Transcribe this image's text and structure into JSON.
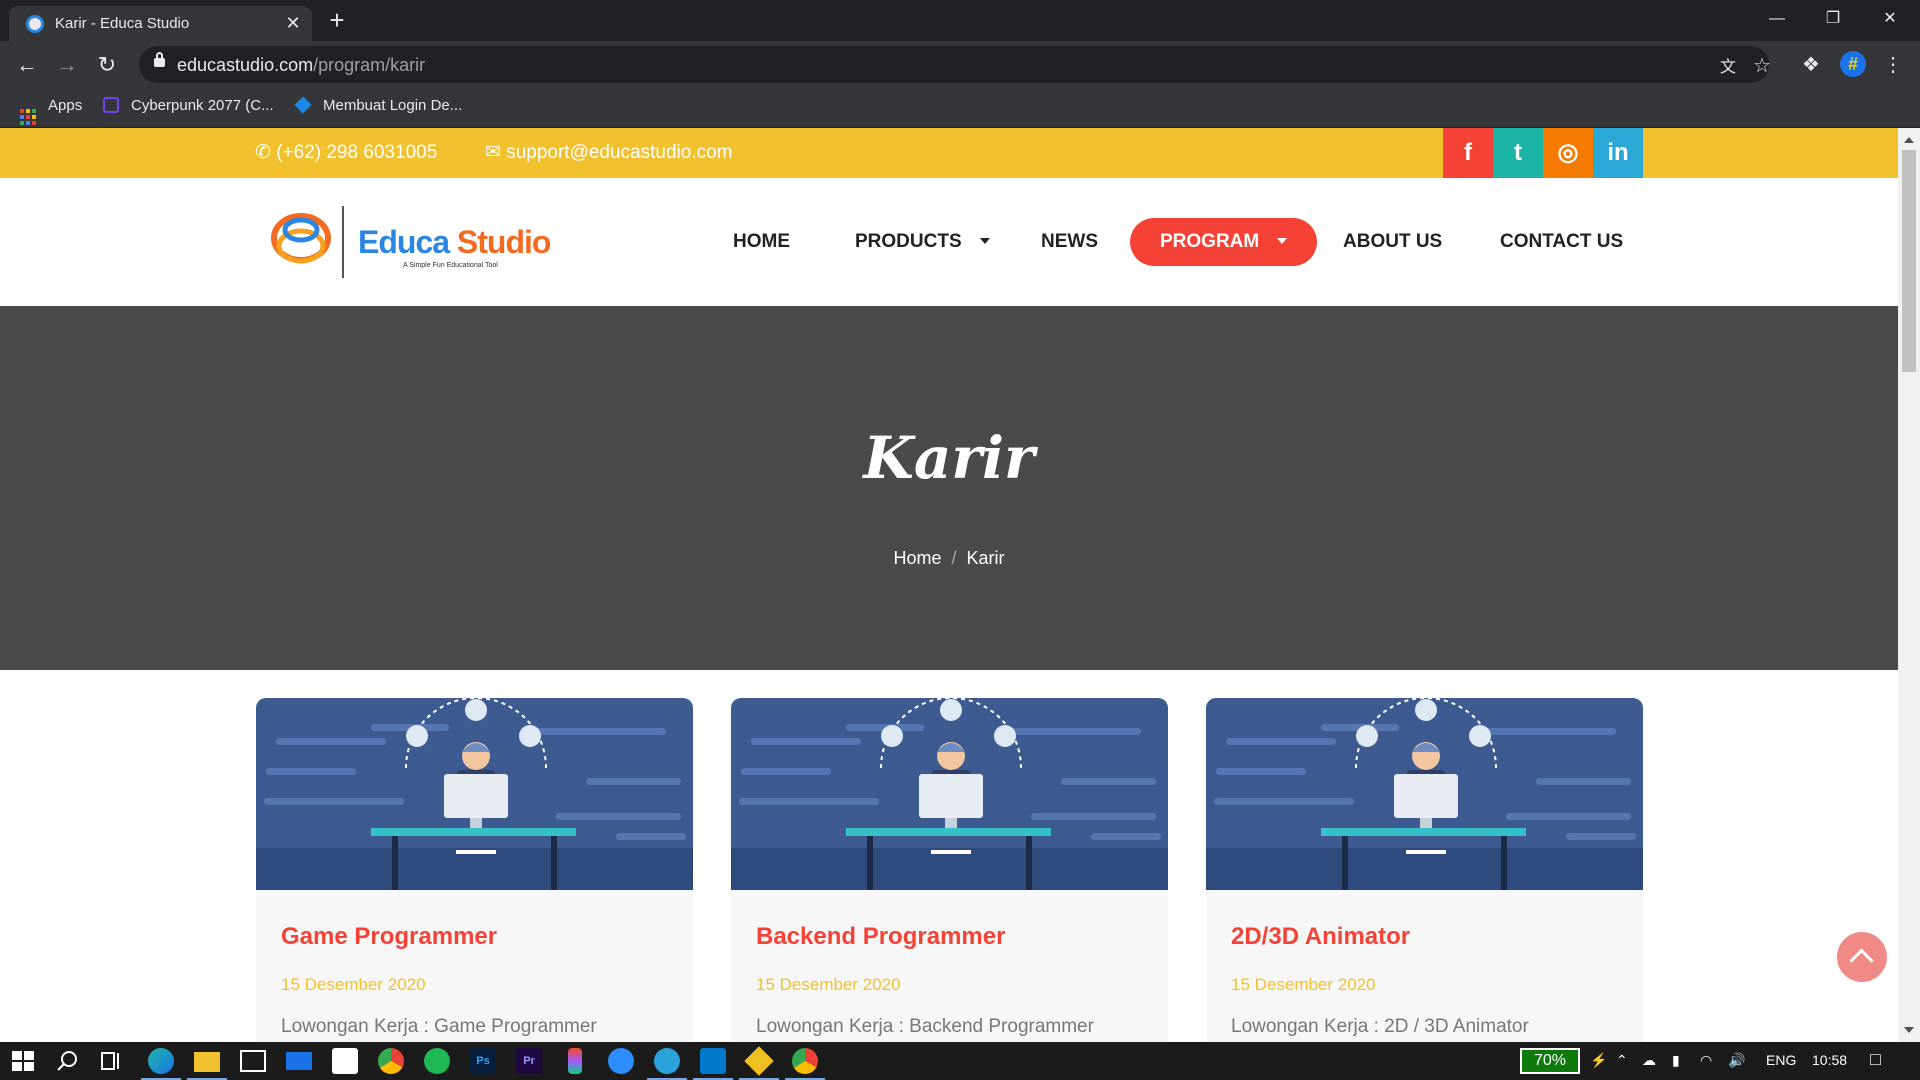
{
  "browser": {
    "tab_title": "Karir - Educa Studio",
    "tab_close": "✕",
    "new_tab": "+",
    "url_host": "educastudio.com",
    "url_path": "/program/karir",
    "bookmarks": [
      {
        "label": "Apps"
      },
      {
        "label": "Cyberpunk 2077 (C..."
      },
      {
        "label": "Membuat Login De..."
      }
    ]
  },
  "topbar": {
    "phone": "(+62) 298 6031005",
    "email": "support@educastudio.com",
    "social": [
      {
        "name": "facebook",
        "glyph": "f",
        "color": "#f44336"
      },
      {
        "name": "twitter",
        "glyph": "t",
        "color": "#1bb4a5"
      },
      {
        "name": "instagram",
        "glyph": "◎",
        "color": "#f57c00"
      },
      {
        "name": "linkedin",
        "glyph": "in",
        "color": "#2ba8d6"
      }
    ]
  },
  "logo": {
    "name_part1": "Educa",
    "name_part2": "Studio",
    "tagline": "A Simple Fun Educational Tool"
  },
  "nav": {
    "home": "HOME",
    "products": "PRODUCTS",
    "news": "NEWS",
    "program": "PROGRAM",
    "about": "ABOUT US",
    "contact": "CONTACT US"
  },
  "hero": {
    "title": "Karir",
    "breadcrumb_home": "Home",
    "breadcrumb_sep": "/",
    "breadcrumb_current": "Karir"
  },
  "cards": [
    {
      "title": "Game Programmer",
      "date": "15 Desember 2020",
      "desc": "Lowongan Kerja : Game Programmer"
    },
    {
      "title": "Backend Programmer",
      "date": "15 Desember 2020",
      "desc": "Lowongan Kerja : Backend Programmer"
    },
    {
      "title": "2D/3D Animator",
      "date": "15 Desember 2020",
      "desc": "Lowongan Kerja : 2D / 3D Animator"
    }
  ],
  "taskbar": {
    "battery": "70%",
    "language": "ENG",
    "time": "10:58"
  },
  "colors": {
    "topbar": "#f2c12e",
    "accent_red": "#f44336",
    "hero_bg": "#4a4a4a",
    "card_bg": "#f7f7f7",
    "illustration_bg": "#3d5a91"
  }
}
